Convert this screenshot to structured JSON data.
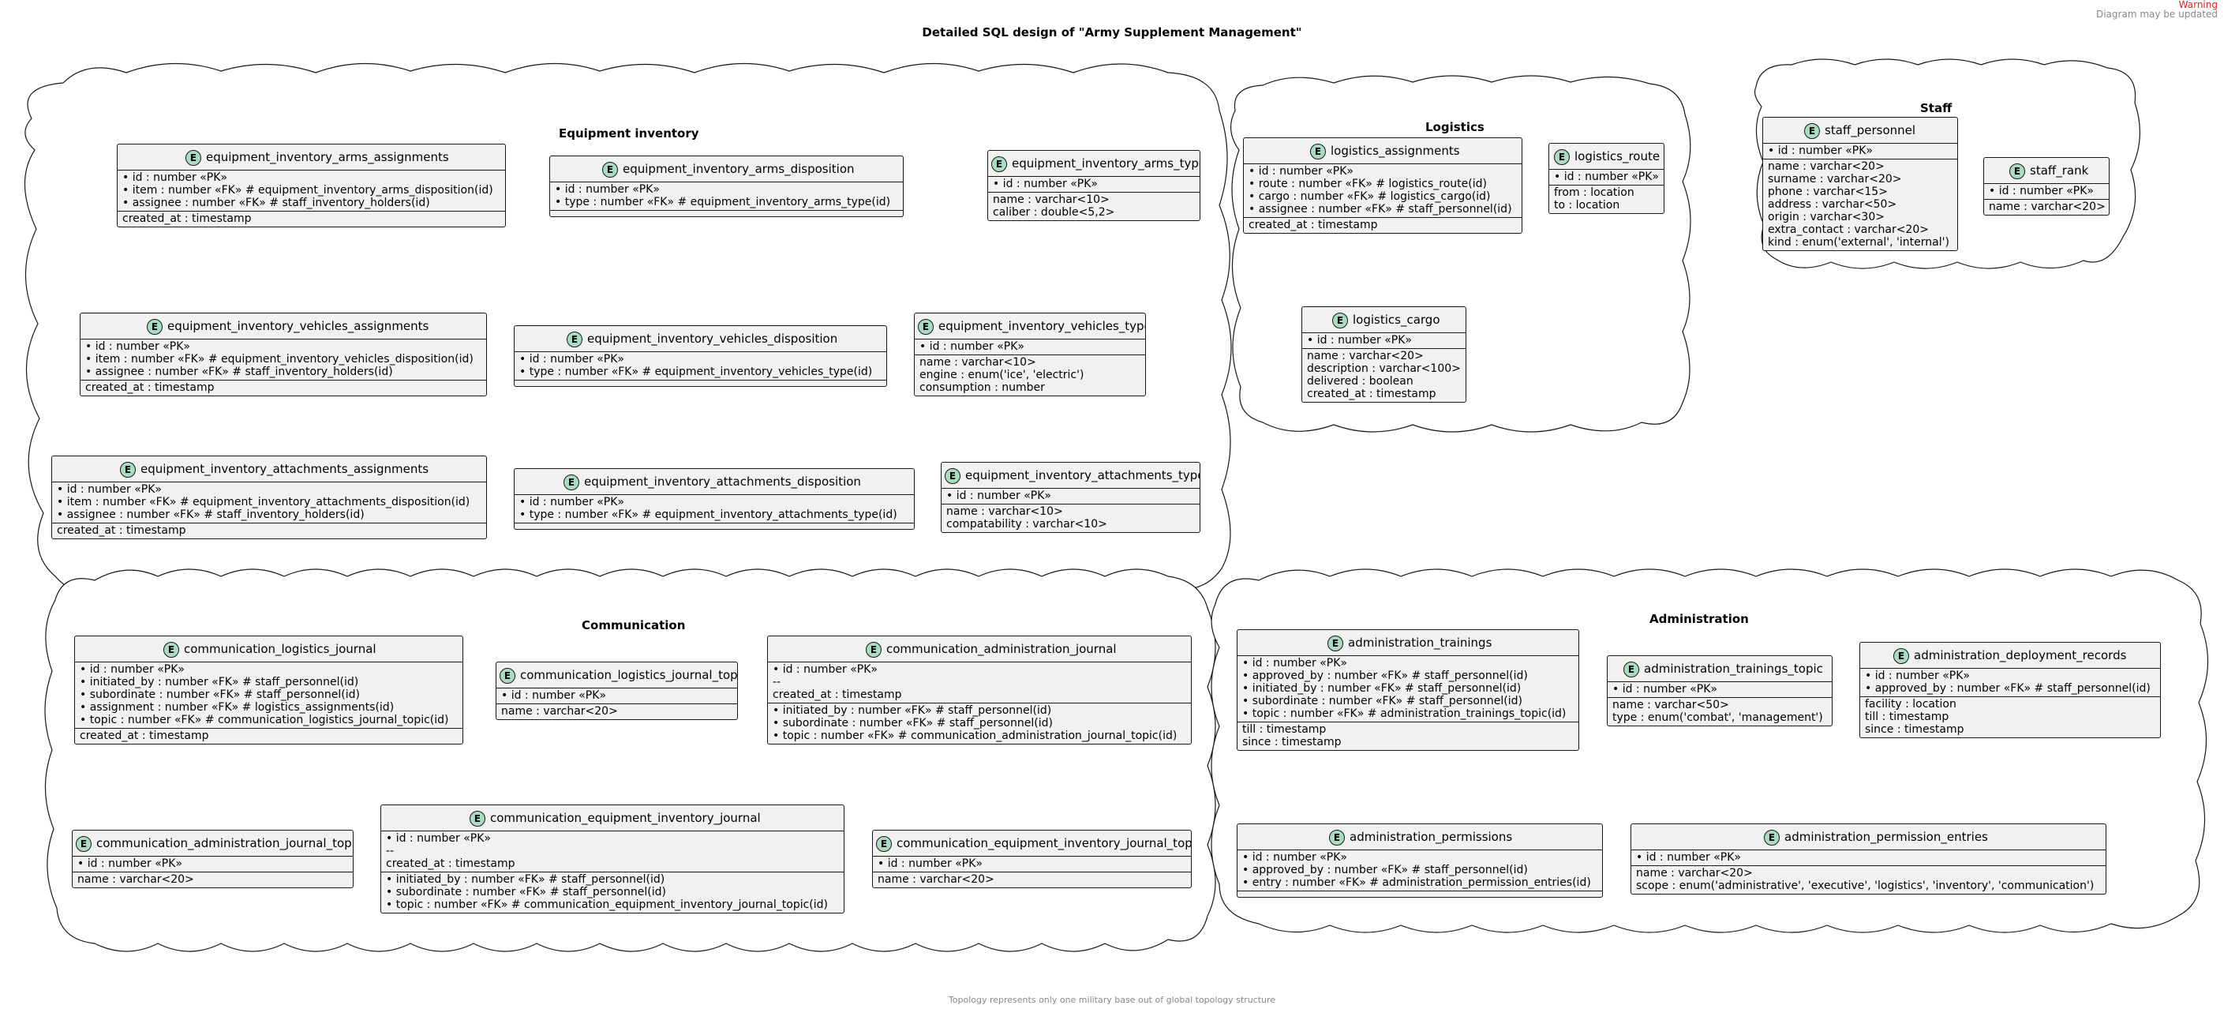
{
  "warning": {
    "line1": "Warning",
    "line2": "Diagram may be updated"
  },
  "title": "Detailed SQL design of \"Army Supplement Management\"",
  "footer": "Topology represents only one military base out of global topology structure",
  "packages": {
    "equipment": "Equipment inventory",
    "logistics": "Logistics",
    "staff": "Staff",
    "communication": "Communication",
    "administration": "Administration"
  },
  "entity_icon": "E",
  "entities": {
    "eq_arms_assign": {
      "name": "equipment_inventory_arms_assignments",
      "sections": [
        [
          "• id : number «PK»",
          "• item : number «FK» # equipment_inventory_arms_disposition(id)",
          "• assignee : number «FK» # staff_inventory_holders(id)"
        ],
        [
          "created_at : timestamp"
        ]
      ]
    },
    "eq_arms_disp": {
      "name": "equipment_inventory_arms_disposition",
      "sections": [
        [
          "• id : number «PK»",
          "• type : number «FK» # equipment_inventory_arms_type(id)"
        ],
        []
      ]
    },
    "eq_arms_type": {
      "name": "equipment_inventory_arms_type",
      "sections": [
        [
          "• id : number «PK»"
        ],
        [
          "name : varchar<10>",
          "caliber : double<5,2>"
        ]
      ]
    },
    "eq_veh_assign": {
      "name": "equipment_inventory_vehicles_assignments",
      "sections": [
        [
          "• id : number «PK»",
          "• item : number «FK» # equipment_inventory_vehicles_disposition(id)",
          "• assignee : number «FK» # staff_inventory_holders(id)"
        ],
        [
          "created_at : timestamp"
        ]
      ]
    },
    "eq_veh_disp": {
      "name": "equipment_inventory_vehicles_disposition",
      "sections": [
        [
          "• id : number «PK»",
          "• type : number «FK» # equipment_inventory_vehicles_type(id)"
        ],
        []
      ]
    },
    "eq_veh_type": {
      "name": "equipment_inventory_vehicles_type",
      "sections": [
        [
          "• id : number «PK»"
        ],
        [
          "name : varchar<10>",
          "engine : enum('ice', 'electric')",
          "consumption : number"
        ]
      ]
    },
    "eq_att_assign": {
      "name": "equipment_inventory_attachments_assignments",
      "sections": [
        [
          "• id : number «PK»",
          "• item : number «FK» # equipment_inventory_attachments_disposition(id)",
          "• assignee : number «FK» # staff_inventory_holders(id)"
        ],
        [
          "created_at : timestamp"
        ]
      ]
    },
    "eq_att_disp": {
      "name": "equipment_inventory_attachments_disposition",
      "sections": [
        [
          "• id : number «PK»",
          "• type : number «FK» # equipment_inventory_attachments_type(id)"
        ],
        []
      ]
    },
    "eq_att_type": {
      "name": "equipment_inventory_attachments_type",
      "sections": [
        [
          "• id : number «PK»"
        ],
        [
          "name : varchar<10>",
          "compatability : varchar<10>"
        ]
      ]
    },
    "log_assign": {
      "name": "logistics_assignments",
      "sections": [
        [
          "• id : number «PK»",
          "• route : number «FK» # logistics_route(id)",
          "• cargo : number «FK» # logistics_cargo(id)",
          "• assignee : number «FK» # staff_personnel(id)"
        ],
        [
          "created_at : timestamp"
        ]
      ]
    },
    "log_route": {
      "name": "logistics_route",
      "sections": [
        [
          "• id : number «PK»"
        ],
        [
          "from : location",
          "to : location"
        ]
      ]
    },
    "log_cargo": {
      "name": "logistics_cargo",
      "sections": [
        [
          "• id : number «PK»"
        ],
        [
          "name : varchar<20>",
          "description : varchar<100>",
          "delivered : boolean",
          "created_at : timestamp"
        ]
      ]
    },
    "staff_personnel": {
      "name": "staff_personnel",
      "sections": [
        [
          "• id : number «PK»"
        ],
        [
          "name : varchar<20>",
          "surname : varchar<20>",
          "phone : varchar<15>",
          "address : varchar<50>",
          "origin : varchar<30>",
          "extra_contact : varchar<20>",
          "kind : enum('external', 'internal')"
        ]
      ]
    },
    "staff_rank": {
      "name": "staff_rank",
      "sections": [
        [
          "• id : number «PK»"
        ],
        [
          "name : varchar<20>"
        ]
      ]
    },
    "com_log_journal": {
      "name": "communication_logistics_journal",
      "sections": [
        [
          "• id : number «PK»",
          "• initiated_by : number «FK» # staff_personnel(id)",
          "• subordinate : number «FK» # staff_personnel(id)",
          "• assignment : number «FK» # logistics_assignments(id)",
          "• topic : number «FK» # communication_logistics_journal_topic(id)"
        ],
        [
          "created_at : timestamp"
        ]
      ]
    },
    "com_log_topic": {
      "name": "communication_logistics_journal_topic",
      "sections": [
        [
          "• id : number «PK»"
        ],
        [
          "name : varchar<20>"
        ]
      ]
    },
    "com_adm_journal": {
      "name": "communication_administration_journal",
      "sections": [
        [
          "• id : number «PK»",
          "--",
          "created_at : timestamp"
        ],
        [
          "• initiated_by : number «FK» # staff_personnel(id)",
          "• subordinate : number «FK» # staff_personnel(id)",
          "• topic : number «FK» # communication_administration_journal_topic(id)"
        ]
      ]
    },
    "com_adm_topic": {
      "name": "communication_administration_journal_topic",
      "sections": [
        [
          "• id : number «PK»"
        ],
        [
          "name : varchar<20>"
        ]
      ]
    },
    "com_eq_journal": {
      "name": "communication_equipment_inventory_journal",
      "sections": [
        [
          "• id : number «PK»",
          "--",
          "created_at : timestamp"
        ],
        [
          "• initiated_by : number «FK» # staff_personnel(id)",
          "• subordinate : number «FK» # staff_personnel(id)",
          "• topic : number «FK» # communication_equipment_inventory_journal_topic(id)"
        ]
      ]
    },
    "com_eq_topic": {
      "name": "communication_equipment_inventory_journal_topic",
      "sections": [
        [
          "• id : number «PK»"
        ],
        [
          "name : varchar<20>"
        ]
      ]
    },
    "adm_trainings": {
      "name": "administration_trainings",
      "sections": [
        [
          "• id : number «PK»",
          "• approved_by : number «FK» # staff_personnel(id)",
          "• initiated_by : number «FK» # staff_personnel(id)",
          "• subordinate : number «FK» # staff_personnel(id)",
          "• topic : number «FK» # administration_trainings_topic(id)"
        ],
        [
          "till : timestamp",
          "since : timestamp"
        ]
      ]
    },
    "adm_trainings_topic": {
      "name": "administration_trainings_topic",
      "sections": [
        [
          "• id : number «PK»"
        ],
        [
          "name : varchar<50>",
          "type : enum('combat', 'management')"
        ]
      ]
    },
    "adm_deploy": {
      "name": "administration_deployment_records",
      "sections": [
        [
          "• id : number «PK»",
          "• approved_by : number «FK» # staff_personnel(id)"
        ],
        [
          "facility : location",
          "till : timestamp",
          "since : timestamp"
        ]
      ]
    },
    "adm_perm": {
      "name": "administration_permissions",
      "sections": [
        [
          "• id : number «PK»",
          "• approved_by : number «FK» # staff_personnel(id)",
          "• entry : number «FK» # administration_permission_entries(id)"
        ],
        []
      ]
    },
    "adm_perm_entries": {
      "name": "administration_permission_entries",
      "sections": [
        [
          "• id : number «PK»"
        ],
        [
          "name : varchar<20>",
          "scope : enum('administrative', 'executive', 'logistics', 'inventory', 'communication')"
        ]
      ]
    }
  }
}
